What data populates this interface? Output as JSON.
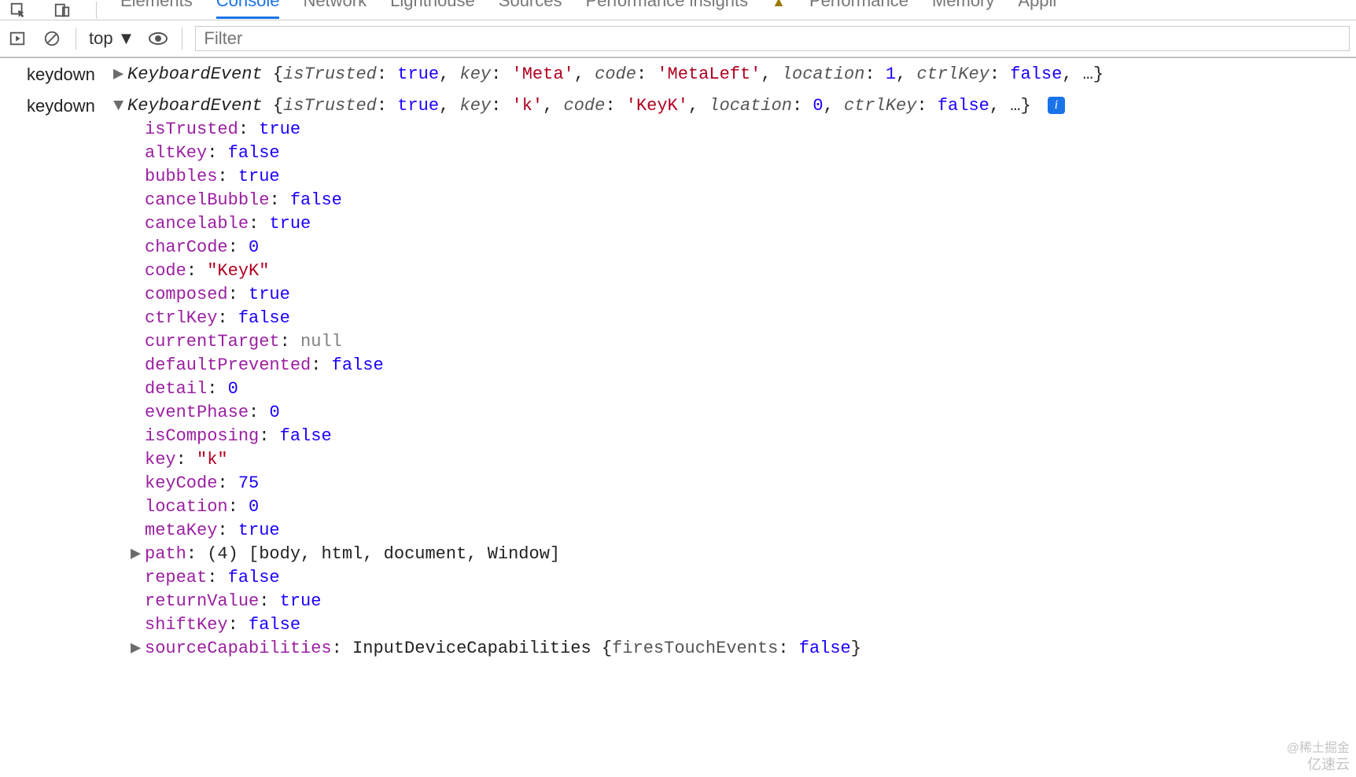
{
  "tabs": {
    "elements": "Elements",
    "console": "Console",
    "network": "Network",
    "lighthouse": "Lighthouse",
    "sources": "Sources",
    "perf_insights": "Performance insights",
    "performance": "Performance",
    "memory": "Memory",
    "application": "Appli"
  },
  "toolbar": {
    "context_label": "top",
    "filter_placeholder": "Filter"
  },
  "log1": {
    "label": "keydown",
    "class": "KeyboardEvent",
    "preview": {
      "isTrusted": "true",
      "key": "'Meta'",
      "code": "'MetaLeft'",
      "location": "1",
      "ctrlKey": "false"
    }
  },
  "log2": {
    "label": "keydown",
    "class": "KeyboardEvent",
    "preview": {
      "isTrusted": "true",
      "key": "'k'",
      "code": "'KeyK'",
      "location": "0",
      "ctrlKey": "false"
    },
    "info_badge": "i",
    "props": {
      "isTrusted": {
        "val": "true",
        "kind": "true"
      },
      "altKey": {
        "val": "false",
        "kind": "false"
      },
      "bubbles": {
        "val": "true",
        "kind": "true"
      },
      "cancelBubble": {
        "val": "false",
        "kind": "false"
      },
      "cancelable": {
        "val": "true",
        "kind": "true"
      },
      "charCode": {
        "val": "0",
        "kind": "num"
      },
      "code": {
        "val": "\"KeyK\"",
        "kind": "str"
      },
      "composed": {
        "val": "true",
        "kind": "true"
      },
      "ctrlKey": {
        "val": "false",
        "kind": "false"
      },
      "currentTarget": {
        "val": "null",
        "kind": "null"
      },
      "defaultPrevented": {
        "val": "false",
        "kind": "false"
      },
      "detail": {
        "val": "0",
        "kind": "num"
      },
      "eventPhase": {
        "val": "0",
        "kind": "num"
      },
      "isComposing": {
        "val": "false",
        "kind": "false"
      },
      "key": {
        "val": "\"k\"",
        "kind": "str"
      },
      "keyCode": {
        "val": "75",
        "kind": "num"
      },
      "location": {
        "val": "0",
        "kind": "num"
      },
      "metaKey": {
        "val": "true",
        "kind": "true"
      },
      "repeat": {
        "val": "false",
        "kind": "false"
      },
      "returnValue": {
        "val": "true",
        "kind": "true"
      },
      "shiftKey": {
        "val": "false",
        "kind": "false"
      }
    },
    "path": {
      "key": "path",
      "count": "(4)",
      "items": [
        "body",
        "html",
        "document",
        "Window"
      ]
    },
    "sourceCapabilities": {
      "key": "sourceCapabilities",
      "class": "InputDeviceCapabilities",
      "inner_key": "firesTouchEvents",
      "inner_val": "false"
    }
  },
  "watermark": {
    "line1": "@稀土掘金",
    "line2": "亿速云"
  }
}
